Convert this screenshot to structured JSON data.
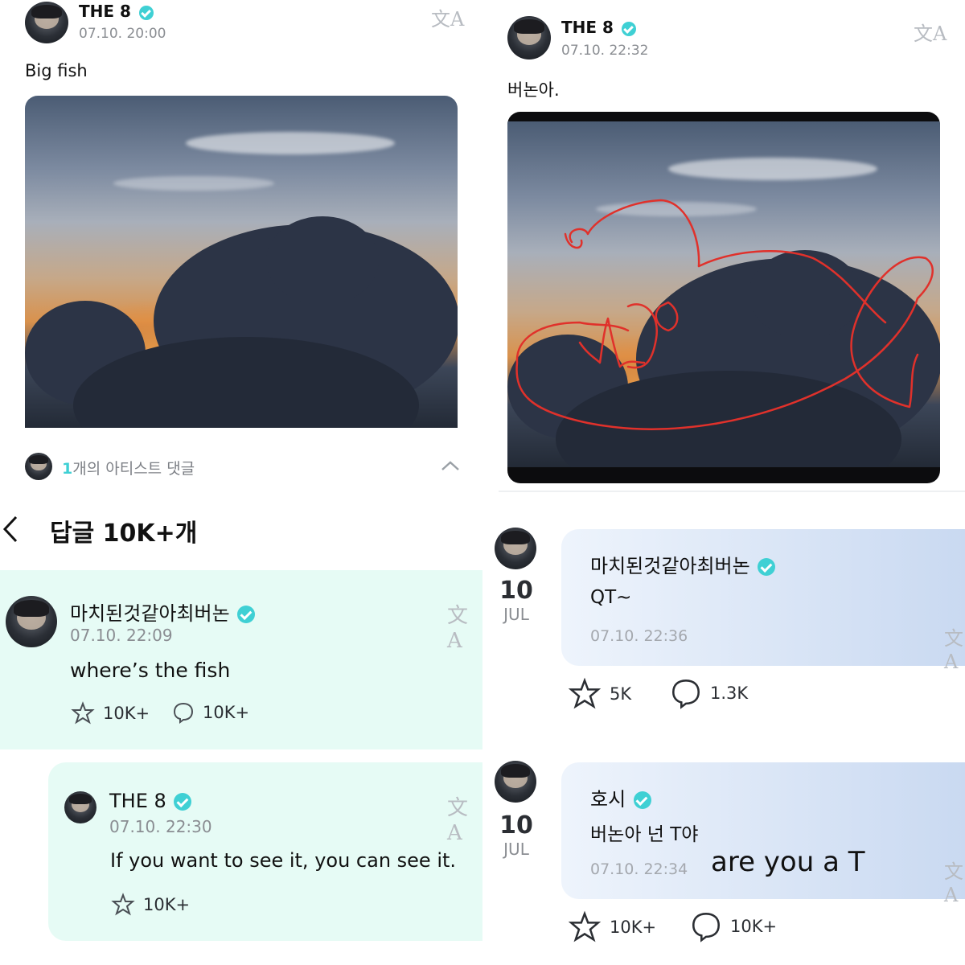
{
  "post_left": {
    "author": "THE 8",
    "time": "07.10. 20:00",
    "text": "Big fish",
    "artist_comments_count": "1",
    "artist_comments_label": "개의 아티스트 댓글"
  },
  "replies_header": {
    "back": "<",
    "title": "답글 10K+개"
  },
  "reply_1": {
    "author": "마치된것같아최버논",
    "time": "07.10. 22:09",
    "text": "where’s the fish",
    "likes": "10K+",
    "comments": "10K+"
  },
  "reply_2": {
    "author": "THE 8",
    "time": "07.10. 22:30",
    "text": "If you want to see it, you can see it.",
    "likes": "10K+"
  },
  "post_right": {
    "author": "THE 8",
    "time": "07.10. 22:32",
    "text": "버논아."
  },
  "comment_1": {
    "day": "10",
    "month": "JUL",
    "author": "마치된것같아최버논",
    "text": "QT~",
    "time": "07.10. 22:36",
    "likes": "5K",
    "comments": "1.3K"
  },
  "comment_2": {
    "day": "10",
    "month": "JUL",
    "author": "호시",
    "text": "버논아 넌 T야",
    "time": "07.10. 22:34",
    "translation_overlay": "are you a T",
    "likes": "10K+",
    "comments": "10K+"
  },
  "icons": {
    "translate": "translate-icon",
    "like": "cheer-star-icon",
    "comment": "speech-bubble-icon",
    "verified": "verified-badge-icon",
    "chevron": "chevron-up-icon",
    "back": "back-arrow-icon"
  },
  "colors": {
    "accent": "#3fd0d4",
    "reply_bg": "#e6fbf5",
    "comment_bg_start": "#eaf1fb",
    "comment_bg_end": "#c9d9f1",
    "drawing": "#e0312b"
  }
}
